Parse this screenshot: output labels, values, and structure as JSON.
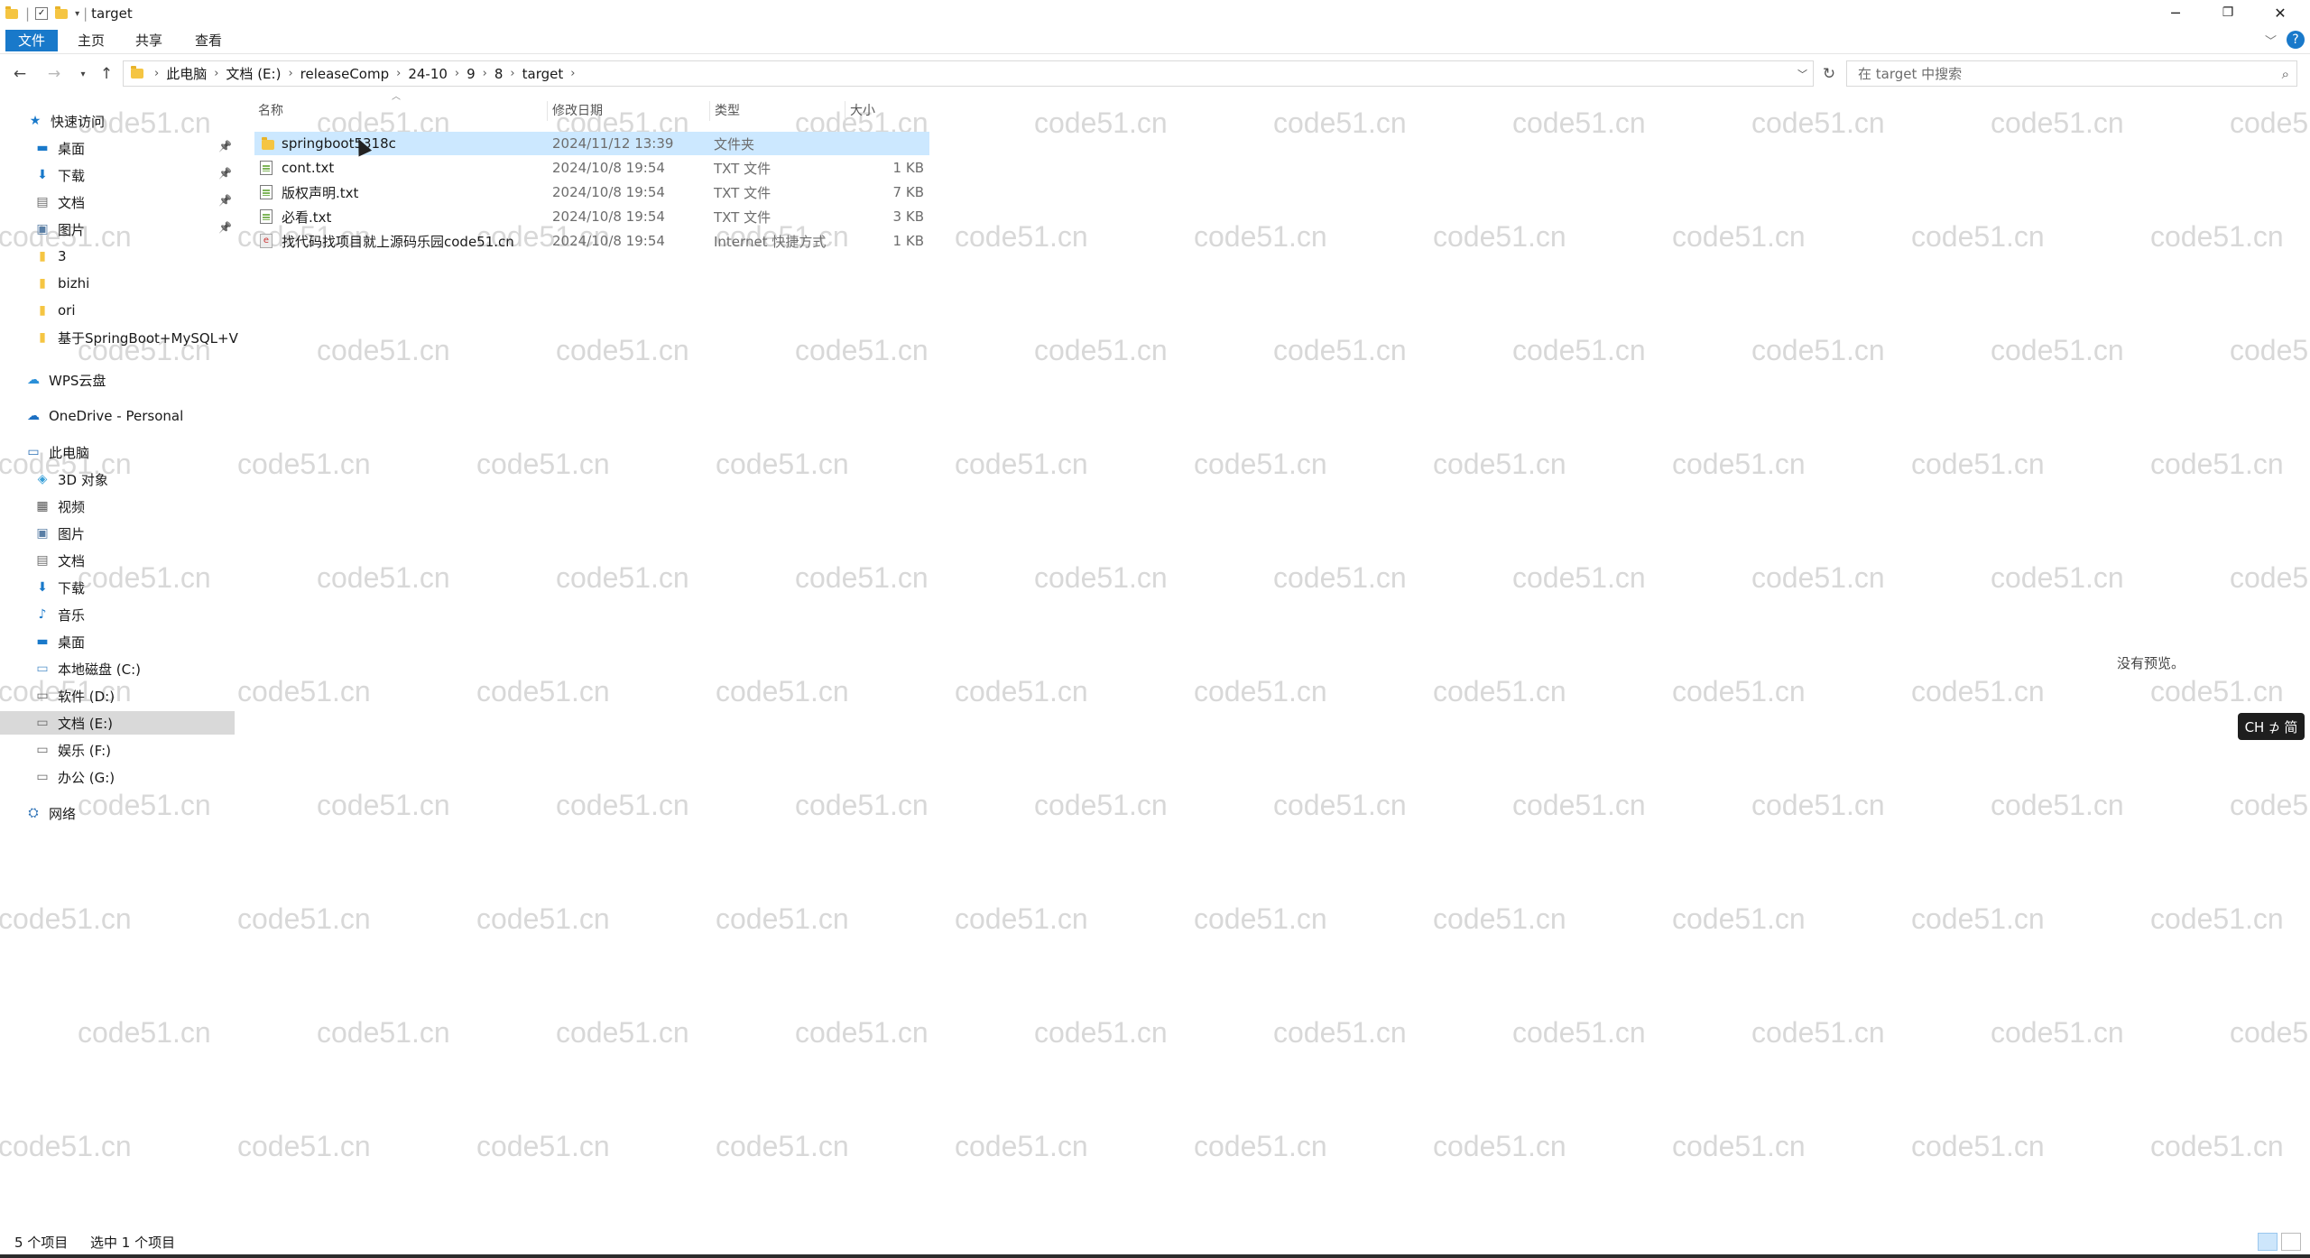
{
  "window": {
    "title": "target",
    "controls": {
      "minimize": "─",
      "restore": "❐",
      "close": "✕"
    }
  },
  "ribbon": {
    "tabs": [
      {
        "label": "文件",
        "active": true
      },
      {
        "label": "主页",
        "active": false
      },
      {
        "label": "共享",
        "active": false
      },
      {
        "label": "查看",
        "active": false
      }
    ],
    "help_label": "?"
  },
  "address": {
    "breadcrumbs": [
      "此电脑",
      "文档 (E:)",
      "releaseComp",
      "24-10",
      "9",
      "8",
      "target"
    ],
    "search_placeholder": "在 target 中搜索"
  },
  "nav": {
    "quick_access": "快速访问",
    "quick_items": [
      {
        "label": "桌面",
        "icon": "desktop-icon",
        "pinned": true
      },
      {
        "label": "下载",
        "icon": "download-icon",
        "pinned": true
      },
      {
        "label": "文档",
        "icon": "document-icon",
        "pinned": true
      },
      {
        "label": "图片",
        "icon": "picture-icon",
        "pinned": true
      },
      {
        "label": "3",
        "icon": "folder-icon",
        "pinned": false
      },
      {
        "label": "bizhi",
        "icon": "folder-icon",
        "pinned": false
      },
      {
        "label": "ori",
        "icon": "folder-icon",
        "pinned": false
      },
      {
        "label": "基于SpringBoot+MySQL+V",
        "icon": "folder-icon",
        "pinned": false
      }
    ],
    "wps": "WPS云盘",
    "onedrive": "OneDrive - Personal",
    "this_pc": "此电脑",
    "pc_items": [
      {
        "label": "3D 对象",
        "icon": "3d-objects-icon"
      },
      {
        "label": "视频",
        "icon": "video-icon"
      },
      {
        "label": "图片",
        "icon": "picture-icon"
      },
      {
        "label": "文档",
        "icon": "document-icon"
      },
      {
        "label": "下载",
        "icon": "download-icon"
      },
      {
        "label": "音乐",
        "icon": "music-icon"
      },
      {
        "label": "桌面",
        "icon": "desktop-icon"
      },
      {
        "label": "本地磁盘 (C:)",
        "icon": "drive-c-icon"
      },
      {
        "label": "软件 (D:)",
        "icon": "drive-icon"
      },
      {
        "label": "文档 (E:)",
        "icon": "drive-icon",
        "selected": true
      },
      {
        "label": "娱乐 (F:)",
        "icon": "drive-icon"
      },
      {
        "label": "办公 (G:)",
        "icon": "drive-icon"
      }
    ],
    "network": "网络"
  },
  "files": {
    "columns": {
      "name": "名称",
      "date": "修改日期",
      "type": "类型",
      "size": "大小"
    },
    "rows": [
      {
        "name": "springboot5318c",
        "date": "2024/11/12 13:39",
        "type": "文件夹",
        "size": "",
        "icon": "folder-icon",
        "selected": true
      },
      {
        "name": "cont.txt",
        "date": "2024/10/8 19:54",
        "type": "TXT 文件",
        "size": "1 KB",
        "icon": "txt-file-icon",
        "selected": false
      },
      {
        "name": "版权声明.txt",
        "date": "2024/10/8 19:54",
        "type": "TXT 文件",
        "size": "7 KB",
        "icon": "txt-file-icon",
        "selected": false
      },
      {
        "name": "必看.txt",
        "date": "2024/10/8 19:54",
        "type": "TXT 文件",
        "size": "3 KB",
        "icon": "txt-file-icon",
        "selected": false
      },
      {
        "name": "找代码找项目就上源码乐园code51.cn",
        "date": "2024/10/8 19:54",
        "type": "Internet 快捷方式",
        "size": "1 KB",
        "icon": "internet-shortcut-icon",
        "selected": false
      }
    ]
  },
  "preview": {
    "text": "没有预览。"
  },
  "ime": {
    "text": "CH ⊅ 简"
  },
  "status": {
    "count": "5 个项目",
    "selected": "选中 1 个项目"
  },
  "watermark": "code51.cn",
  "colors": {
    "accent": "#1979ca",
    "selection": "#cce8ff",
    "nav_selection": "#d9d9d9"
  }
}
